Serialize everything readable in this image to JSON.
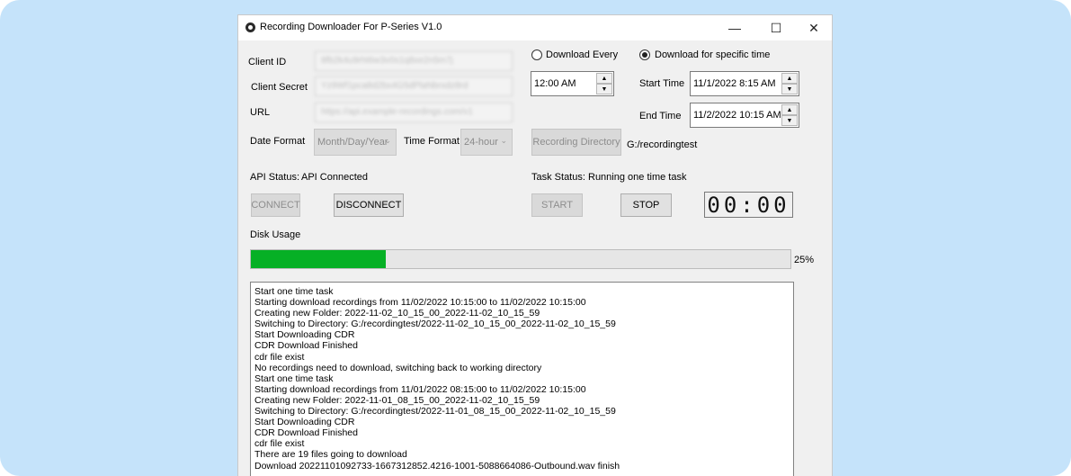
{
  "window": {
    "title": "Recording Downloader For P-Series V1.0",
    "minimize_glyph": "—",
    "maximize_glyph": "☐",
    "close_glyph": "✕",
    "icon": "app-gear-icon"
  },
  "credentials": {
    "client_id_label": "Client ID",
    "client_id_value": "8fb2k4u9rht6w3v0s1q8xe2n5m7j",
    "client_secret_label": "Client Secret",
    "client_secret_value": "Yz9Wf1pca8d2bx4G5dPlaNbrxdz8rd",
    "url_label": "URL",
    "url_value": "https://api.example-recordings.com/v1"
  },
  "formats": {
    "date_format_label": "Date Format",
    "date_format_value": "Month/Day/Year",
    "time_format_label": "Time Format",
    "time_format_value": "24-hour"
  },
  "schedule": {
    "download_every_label": "Download Every",
    "download_every_checked": false,
    "download_every_time": "12:00 AM",
    "specific_time_label": "Download for specific time",
    "specific_time_checked": true,
    "start_time_label": "Start Time",
    "start_time_value": "11/1/2022 8:15 AM",
    "end_time_label": "End Time",
    "end_time_value": "11/2/2022 10:15 AM"
  },
  "recording": {
    "directory_button": "Recording Directory",
    "directory_path": "G:/recordingtest"
  },
  "api": {
    "status_label": "API Status:",
    "status_value": "API Connected",
    "connect_button": "CONNECT",
    "disconnect_button": "DISCONNECT"
  },
  "task": {
    "status_label": "Task Status:",
    "status_value": "Running one time task",
    "start_button": "START",
    "stop_button": "STOP",
    "timer": "00:00"
  },
  "disk": {
    "label": "Disk Usage",
    "percent_text": "25%",
    "fraction": 0.25,
    "fill_color": "#06b025"
  },
  "log": [
    "Start one time task",
    "Starting download recordings from 11/02/2022 10:15:00 to 11/02/2022 10:15:00",
    "Creating new Folder: 2022-11-02_10_15_00_2022-11-02_10_15_59",
    "Switching to Directory: G:/recordingtest/2022-11-02_10_15_00_2022-11-02_10_15_59",
    "Start Downloading CDR",
    "CDR Download Finished",
    "cdr file exist",
    "No recordings need to download, switching back to working directory",
    "Start one time task",
    "Starting download recordings from 11/01/2022 08:15:00 to 11/02/2022 10:15:00",
    "Creating new Folder: 2022-11-01_08_15_00_2022-11-02_10_15_59",
    "Switching to Directory: G:/recordingtest/2022-11-01_08_15_00_2022-11-02_10_15_59",
    "Start Downloading CDR",
    "CDR Download Finished",
    "cdr file exist",
    "There are 19 files going to download",
    "Download 20221101092733-1667312852.4216-1001-5088664086-Outbound.wav finish"
  ]
}
